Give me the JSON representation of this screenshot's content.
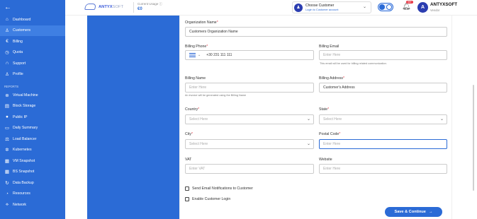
{
  "sidebar": {
    "back_icon": "arrow-left-icon",
    "items": [
      {
        "label": "Dashboard",
        "icon": "home-icon",
        "glyph": "⌂"
      },
      {
        "label": "Customers",
        "icon": "user-icon",
        "glyph": "♙",
        "active": true
      },
      {
        "label": "Billing",
        "icon": "euro-icon",
        "glyph": "€"
      },
      {
        "label": "Quota",
        "icon": "clock-icon",
        "glyph": "◷"
      },
      {
        "label": "Support",
        "icon": "headset-icon",
        "glyph": "∩"
      },
      {
        "label": "Profile",
        "icon": "user-icon",
        "glyph": "♙"
      }
    ],
    "reports_label": "REPORTS",
    "reports": [
      {
        "label": "Virtual Machine",
        "icon": "vm-icon",
        "glyph": "⊛"
      },
      {
        "label": "Block Storage",
        "icon": "storage-icon",
        "glyph": "▤"
      },
      {
        "label": "Public IP",
        "icon": "location-icon",
        "glyph": "●"
      },
      {
        "label": "Daily Summary",
        "icon": "summary-icon",
        "glyph": "▭"
      },
      {
        "label": "Load Balancer",
        "icon": "balancer-icon",
        "glyph": "⚖"
      },
      {
        "label": "Kubernetes",
        "icon": "kubernetes-icon",
        "glyph": "✲"
      },
      {
        "label": "VM Snapshot",
        "icon": "snapshot-icon",
        "glyph": "▦"
      },
      {
        "label": "BS Snapshot",
        "icon": "snapshot-icon",
        "glyph": "▦"
      },
      {
        "label": "Data Backup",
        "icon": "backup-icon",
        "glyph": "↻"
      },
      {
        "label": "Resources",
        "icon": "resources-icon",
        "glyph": "◔"
      },
      {
        "label": "Network",
        "icon": "network-icon",
        "glyph": "⟡"
      }
    ]
  },
  "header": {
    "logo_name": "ANTYX",
    "logo_suffix": "SOFT",
    "usage_label": "Current Usage",
    "usage_value": "€0",
    "choose_title": "Choose Customer",
    "choose_sub": "Login to Customer account",
    "notification_count": "99+",
    "avatar_letter": "A",
    "user_name": "ANTYXSOFT",
    "user_role": "Vendor"
  },
  "form": {
    "org_name_label": "Organization Name",
    "org_name_value": "Customers Organization Name",
    "billing_phone_label": "Billing Phone",
    "billing_phone_value": "+30 231 111 111",
    "billing_email_label": "Billing Email",
    "billing_email_placeholder": "Enter Here",
    "billing_email_hint": "This email will be used for billing related communication.",
    "billing_name_label": "Billing Name",
    "billing_name_placeholder": "Enter Here",
    "billing_name_hint": "An invoice will be generated using the Billing Name",
    "billing_address_label": "Billing Address",
    "billing_address_value": "Customer's Address",
    "country_label": "Country",
    "country_placeholder": "Select Here",
    "state_label": "State",
    "state_placeholder": "Select Here",
    "city_label": "City",
    "city_placeholder": "Select Here",
    "postal_label": "Postal Code",
    "postal_placeholder": "Enter Here",
    "vat_label": "VAT",
    "vat_placeholder": "Enter VAT",
    "website_label": "Website",
    "website_placeholder": "Enter Here",
    "chk_email_label": "Send Email Notifications to Customer",
    "chk_login_label": "Enable Customer Login",
    "save_label": "Save & Continue",
    "required_mark": "*"
  },
  "colors": {
    "primary": "#2b6bd6",
    "sidebar_active": "#3f7fe3",
    "required": "#e63946"
  }
}
